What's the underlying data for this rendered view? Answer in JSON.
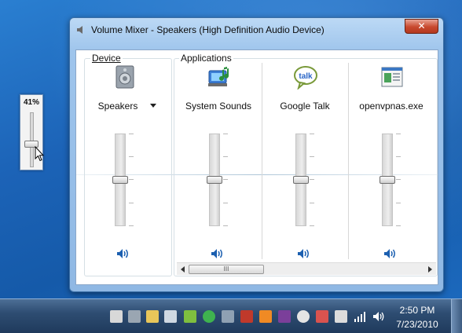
{
  "mini_volume": {
    "percent_label": "41%",
    "level": 0.41
  },
  "window": {
    "title": "Volume Mixer - Speakers (High Definition Audio Device)",
    "close_label": "✕"
  },
  "groups": {
    "device": "Device",
    "applications": "Applications"
  },
  "device": {
    "name": "Speakers",
    "level": 0.5
  },
  "applications": [
    {
      "name": "System Sounds",
      "icon": "system-sounds-icon",
      "level": 0.5
    },
    {
      "name": "Google Talk",
      "icon": "google-talk-icon",
      "level": 0.5
    },
    {
      "name": "openvpnas.exe",
      "icon": "openvpn-app-icon",
      "level": 0.5
    }
  ],
  "google_talk_badge": "talk",
  "scrollbar": {
    "thumb_grip": "III"
  },
  "taskbar": {
    "time": "2:50 PM",
    "date": "7/23/2010"
  },
  "colors": {
    "accent": "#1c63b7",
    "speaker_blue": "#1b5fb0"
  }
}
